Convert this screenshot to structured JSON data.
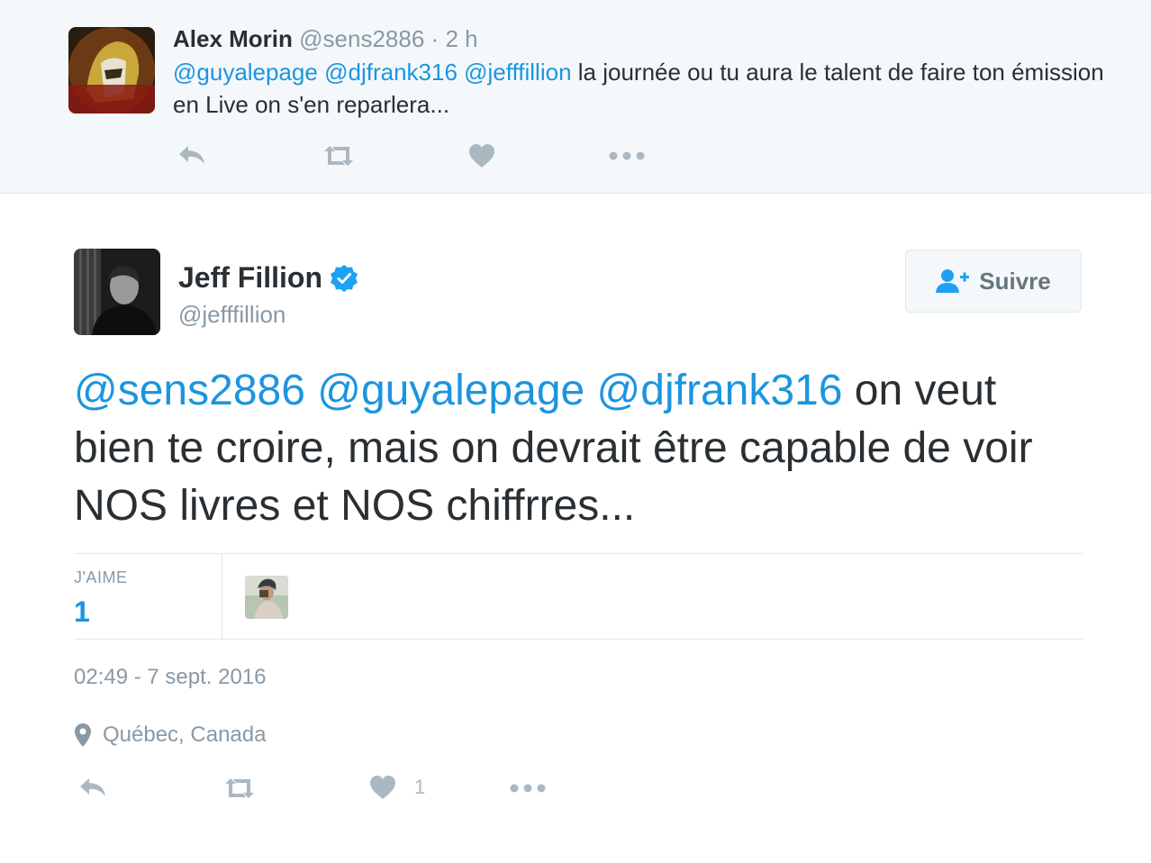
{
  "parent_tweet": {
    "name": "Alex Morin",
    "handle": "@sens2886",
    "separator": "·",
    "time": "2 h",
    "mentions": [
      "@guyalepage",
      "@djfrank316",
      "@jefffillion"
    ],
    "text": "la journée ou tu aura le talent de faire ton émission en Live on s'en reparlera..."
  },
  "main_tweet": {
    "name": "Jeff Fillion",
    "handle": "@jefffillion",
    "follow_label": "Suivre",
    "mentions": [
      "@sens2886",
      "@guyalepage",
      "@djfrank316"
    ],
    "text": "on veut bien te croire, mais on devrait être capable de voir NOS livres et NOS chiffrres...",
    "likes_label": "J'AIME",
    "likes_count": "1",
    "timestamp": "02:49 - 7 sept. 2016",
    "location": "Québec, Canada",
    "like_action_count": "1"
  },
  "colors": {
    "mention": "#1b95e0",
    "verified": "#1da1f2",
    "action_icon": "#aab8c2",
    "muted_text": "#8899a6"
  },
  "icons": [
    "reply-icon",
    "retweet-icon",
    "heart-icon",
    "more-icon",
    "verified-icon",
    "follow-person-icon",
    "location-pin-icon"
  ]
}
